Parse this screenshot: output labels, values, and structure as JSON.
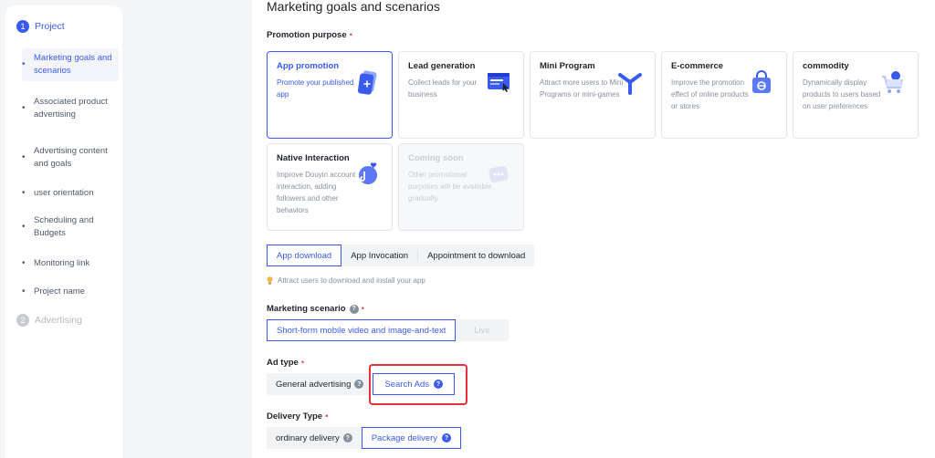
{
  "sidebar": {
    "step1": {
      "num": "1",
      "label": "Project"
    },
    "items": [
      {
        "label": "Marketing goals and scenarios"
      },
      {
        "label": "Associated product advertising"
      },
      {
        "label": "Advertising content and goals"
      },
      {
        "label": "user orientation"
      },
      {
        "label": "Scheduling and Budgets"
      },
      {
        "label": "Monitoring link"
      },
      {
        "label": "Project name"
      }
    ],
    "step2": {
      "num": "2",
      "label": "Advertising"
    },
    "bullet": "•"
  },
  "main": {
    "title": "Marketing goals and scenarios",
    "promotion_purpose": {
      "label": "Promotion purpose",
      "required": "•",
      "cards": [
        {
          "title": "App promotion",
          "desc": "Promote your published app",
          "icon": "phone-plus-icon",
          "state": "selected"
        },
        {
          "title": "Lead generation",
          "desc": "Collect leads for your business",
          "icon": "form-window-icon",
          "state": "normal"
        },
        {
          "title": "Mini Program",
          "desc": "Attract more users to Mini Programs or mini-games",
          "icon": "mini-program-icon",
          "state": "normal"
        },
        {
          "title": "E-commerce",
          "desc": "Improve the promotion effect of online products or stores",
          "icon": "shopping-bag-icon",
          "state": "normal"
        },
        {
          "title": "commodity",
          "desc": "Dynamically display products to users based on user preferences",
          "icon": "shopping-cart-icon",
          "state": "normal"
        },
        {
          "title": "Native Interaction",
          "desc": "Improve Douyin account interaction, adding followers and other behaviors",
          "icon": "heart-chat-icon",
          "state": "normal"
        },
        {
          "title": "Coming soon",
          "desc": "Other promotional purposes will be available gradually.",
          "icon": "more-icon",
          "state": "disabled"
        }
      ]
    },
    "sub_goal": {
      "options": [
        "App download",
        "App Invocation",
        "Appointment to download"
      ],
      "selected": "App download",
      "hint": "Attract users to download and install your app"
    },
    "marketing_scenario": {
      "label": "Marketing scenario",
      "required": "•",
      "options": [
        "Short-form mobile video and image-and-text",
        "Live"
      ],
      "selected": "Short-form mobile video and image-and-text"
    },
    "ad_type": {
      "label": "Ad type",
      "required": "•",
      "options": [
        "General advertising",
        "Search Ads"
      ],
      "selected": "Search Ads"
    },
    "delivery_type": {
      "label": "Delivery Type",
      "required": "•",
      "options": [
        "ordinary delivery",
        "Package delivery"
      ],
      "selected": "Package delivery"
    },
    "help_glyph": "?"
  },
  "colors": {
    "accent": "#3a5bf0",
    "highlight": "#e5303f",
    "required": "#e5484d"
  }
}
